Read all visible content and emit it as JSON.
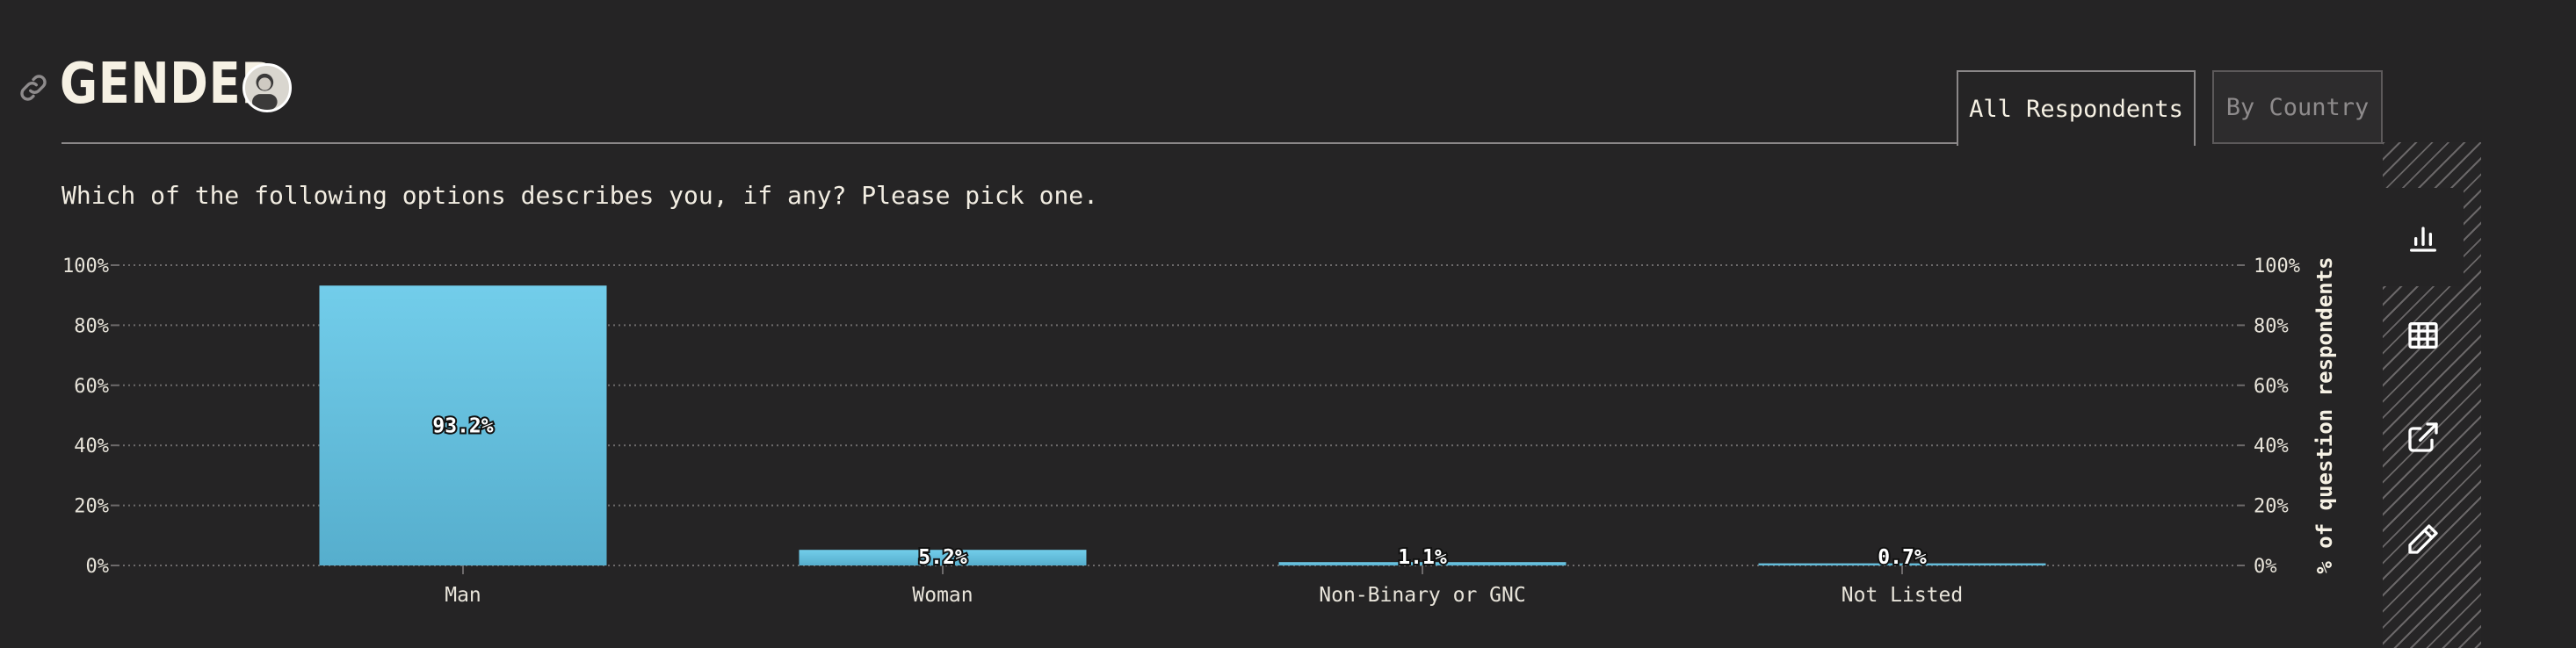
{
  "header": {
    "title": "GENDER",
    "link_icon": "link-icon",
    "avatar_icon": "avatar"
  },
  "tabs": [
    {
      "label": "All Respondents",
      "active": true
    },
    {
      "label": "By Country",
      "active": false
    }
  ],
  "question": "Which of the following options describes you, if any? Please pick one.",
  "sidebar": {
    "items": [
      {
        "icon": "bar-chart-icon",
        "active": true
      },
      {
        "icon": "table-icon",
        "active": false
      },
      {
        "icon": "share-icon",
        "active": false
      },
      {
        "icon": "edit-icon",
        "active": false
      }
    ]
  },
  "colors": {
    "background": "#252425",
    "bar_top": "#72cdea",
    "bar_bottom": "#56aecd",
    "gridline": "#6d6a6b",
    "text": "#f2ede2"
  },
  "chart_data": {
    "type": "bar",
    "categories": [
      "Man",
      "Woman",
      "Non-Binary or GNC",
      "Not Listed"
    ],
    "values": [
      93.2,
      5.2,
      1.1,
      0.7
    ],
    "data_labels": [
      "93.2%",
      "5.2%",
      "1.1%",
      "0.7%"
    ],
    "ylim": [
      0,
      100
    ],
    "yticks": [
      "0%",
      "20%",
      "40%",
      "60%",
      "80%",
      "100%"
    ],
    "ylabel": "% of question respondents",
    "grid": true
  }
}
